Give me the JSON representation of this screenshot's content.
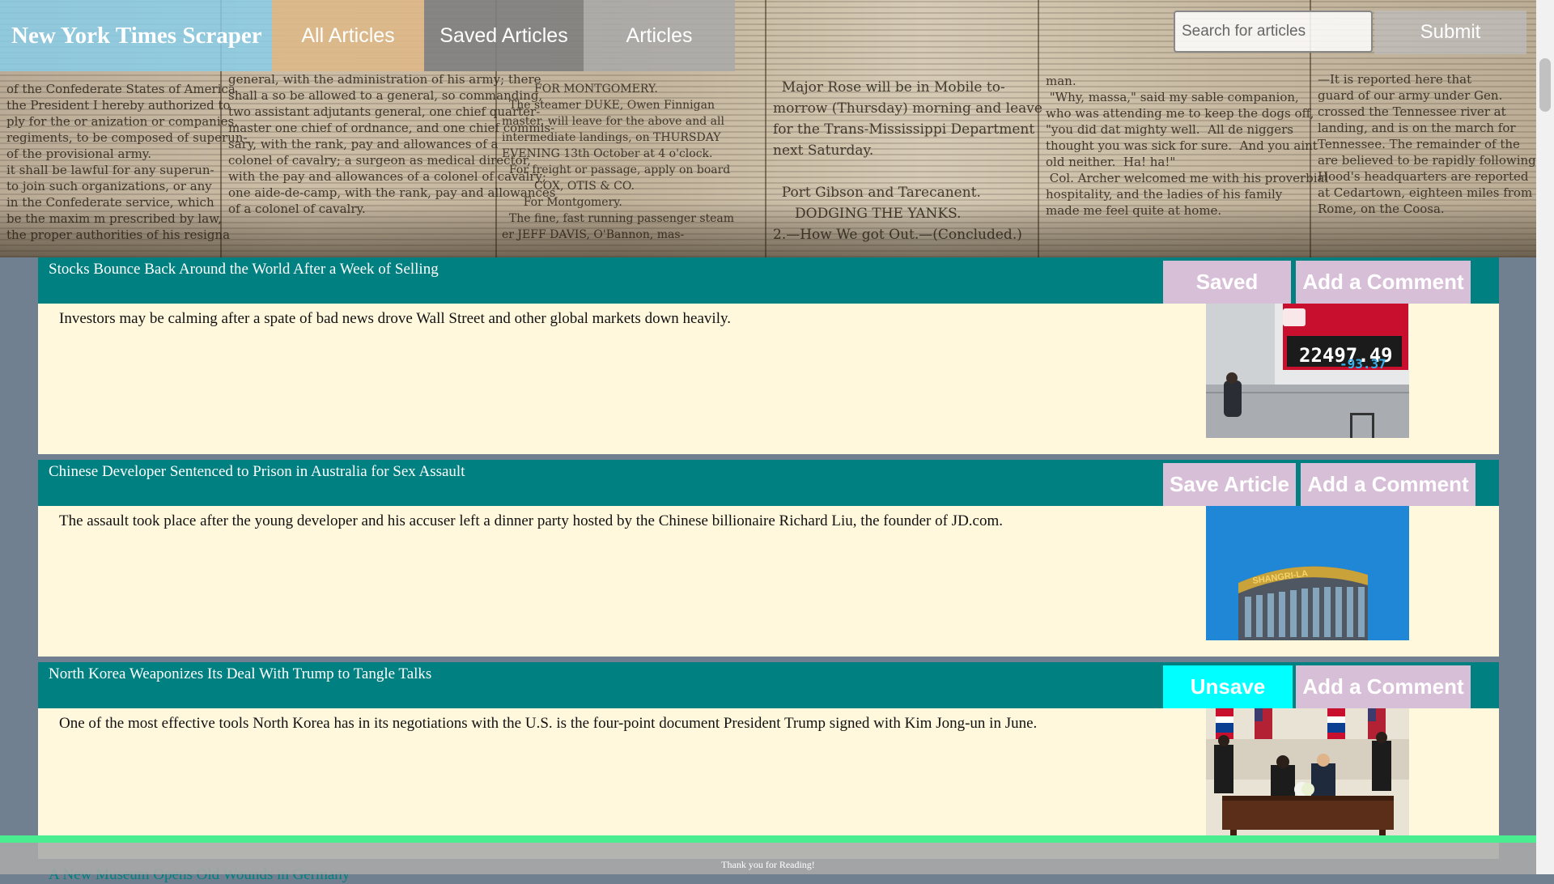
{
  "nav": {
    "brand": "New York Times Scraper",
    "links": [
      "All Articles",
      "Saved Articles",
      "Articles"
    ],
    "search_placeholder": "Search for articles",
    "submit_label": "Submit"
  },
  "articles": [
    {
      "title": "Stocks Bounce Back Around the World After a Week of Selling",
      "summary": "Investors may be calming after a spate of bad news drove Wall Street and other global markets down heavily.",
      "save_label": "Saved",
      "comment_label": "Add a Comment",
      "image": "stock-board-photo",
      "image_text": [
        "22497.49",
        "-93.37"
      ]
    },
    {
      "title": "Chinese Developer Sentenced to Prison in Australia for Sex Assault",
      "summary": "The assault took place after the young developer and his accuser left a dinner party hosted by the Chinese billionaire Richard Liu, the founder of JD.com.",
      "save_label": "Save Article",
      "comment_label": "Add a Comment",
      "image": "shangri-la-building-photo",
      "image_text": [
        "SHANGRI-LA"
      ]
    },
    {
      "title": "North Korea Weaponizes Its Deal With Trump to Tangle Talks",
      "summary": "One of the most effective tools North Korea has in its negotiations with the U.S. is the four-point document President Trump signed with Kim Jong-un in June.",
      "save_label": "Unsave",
      "comment_label": "Add a Comment",
      "image": "summit-signing-photo"
    }
  ],
  "footer": {
    "text": "Thank you for Reading!",
    "peek_title": "A New Museum Opens Old Wounds in Germany"
  },
  "colors": {
    "teal": "#008080",
    "cream": "#fff8dc",
    "thistle": "#d8bfd8",
    "cyan": "#00ffff",
    "green": "#4aed8f"
  }
}
